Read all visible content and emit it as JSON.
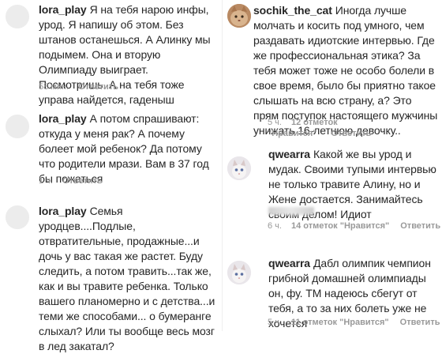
{
  "left": [
    {
      "username": "lora_play",
      "text": "Я на тебя нарою инфы, урод. Я напишу об этом. Без штанов останешься. А Алинку мы подымем. Она и вторую Олимпиаду выиграет. Посмотришь. А на тебя тоже управа найдется, гаденыш",
      "time": "58 мин.",
      "reply": "Ответить"
    },
    {
      "username": "lora_play",
      "text": "А потом спрашивают: откуда у меня рак? А почему болеет мой ребенок? Да потому что родители мрази. Вам в 37 год бы пожаться",
      "time": "1 ч.",
      "reply": "Ответить"
    },
    {
      "username": "lora_play",
      "text": "Семья уродцев....Подлые, отвратительные, продажные...и дочь у вас такая же растет. Буду следить, а потом травить...так же, как и вы травите ребенка. Только вашего планомерно и с детства...и теми же способами... о бумеранге слыхал? Или ты вообще весь мозг в лед закатал?",
      "time": "",
      "reply": ""
    }
  ],
  "right": [
    {
      "username": "sochik_the_cat",
      "text": "Иногда лучше молчать и косить под умного, чем раздавать идиотские интервью. Где же профессиональная этика? За тебя может тоже не особо болели в свое время, было бы приятно такое слышать на всю страну, а? Это прям поступок настоящего мужчины унижать 16-летнюю девочку..",
      "time": "5 ч.",
      "likes": "12 отметок \"Нравится\"",
      "reply": "Ответить"
    },
    {
      "username": "qwearra",
      "text": "Какой же вы урод и мудак. Своими тупыми интервью не только травите Алину, но и Жене достается. Занимайтесь своим делом! Идиот",
      "time": "6 ч.",
      "likes": "14 отметок \"Нравится\"",
      "reply": "Ответить"
    },
    {
      "username": "qwearra",
      "text": "Дабл олимпик чемпион грибной домашней олимпиады он, фу. ТМ надеюсь сбегут от тебя, а то за них болеть уже не хочется",
      "time": "5 ч.",
      "likes": "11 отметок \"Нравится\"",
      "reply": "Ответить"
    }
  ],
  "colors": {
    "text": "#262626",
    "meta": "#999999",
    "background": "#ffffff"
  },
  "icons": {
    "avatar_blank": "person-avatar",
    "avatar_cat": "cat-avatar",
    "avatar_kitten": "kitten-avatar"
  }
}
